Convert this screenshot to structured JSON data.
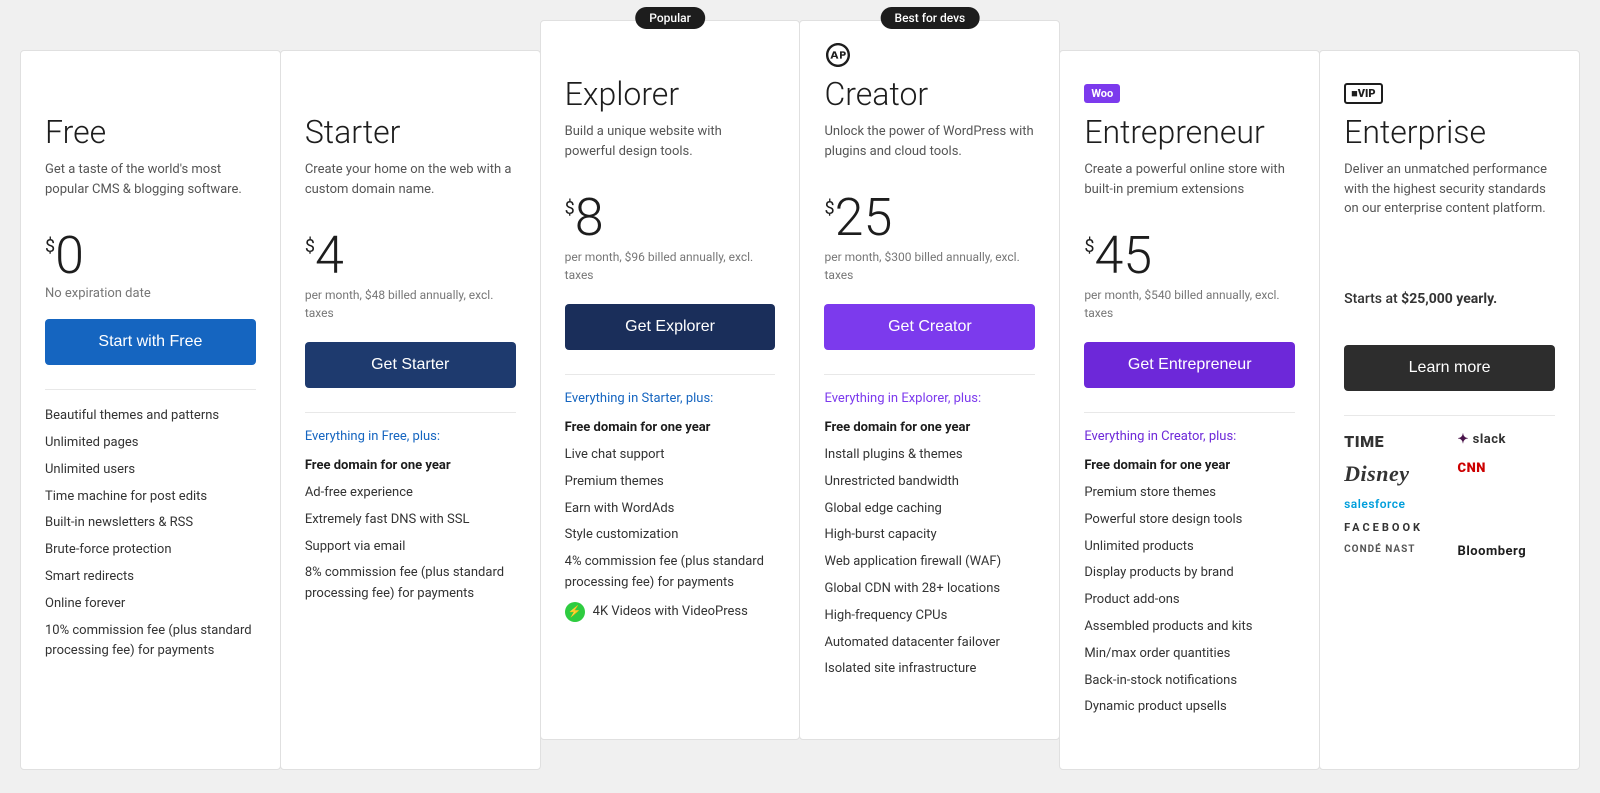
{
  "plans": [
    {
      "id": "free",
      "name": "Free",
      "badge": null,
      "icon": null,
      "desc": "Get a taste of the world's most popular CMS & blogging software.",
      "price": "0",
      "price_sub": "No expiration date",
      "cta_label": "Start with Free",
      "cta_class": "cta-blue",
      "everything_label": null,
      "features": [
        {
          "text": "Beautiful themes and patterns",
          "bold": false
        },
        {
          "text": "Unlimited pages",
          "bold": false
        },
        {
          "text": "Unlimited users",
          "bold": false
        },
        {
          "text": "Time machine for post edits",
          "bold": false
        },
        {
          "text": "Built-in newsletters & RSS",
          "bold": false
        },
        {
          "text": "Brute-force protection",
          "bold": false
        },
        {
          "text": "Smart redirects",
          "bold": false
        },
        {
          "text": "Online forever",
          "bold": false
        },
        {
          "text": "10% commission fee (plus standard processing fee) for payments",
          "bold": false
        }
      ]
    },
    {
      "id": "starter",
      "name": "Starter",
      "badge": null,
      "icon": null,
      "desc": "Create your home on the web with a custom domain name.",
      "price": "4",
      "price_sub": "per month, $48 billed annually, excl. taxes",
      "cta_label": "Get Starter",
      "cta_class": "cta-dark-blue",
      "everything_label": "Everything in Free, plus:",
      "everything_color": "blue",
      "features": [
        {
          "text": "Free domain for one year",
          "bold": true
        },
        {
          "text": "Ad-free experience",
          "bold": false
        },
        {
          "text": "Extremely fast DNS with SSL",
          "bold": false
        },
        {
          "text": "Support via email",
          "bold": false
        },
        {
          "text": "8% commission fee (plus standard processing fee) for payments",
          "bold": false
        }
      ]
    },
    {
      "id": "explorer",
      "name": "Explorer",
      "badge": "Popular",
      "icon": null,
      "desc": "Build a unique website with powerful design tools.",
      "price": "8",
      "price_sub": "per month, $96 billed annually, excl. taxes",
      "cta_label": "Get Explorer",
      "cta_class": "cta-navy",
      "everything_label": "Everything in Starter, plus:",
      "everything_color": "blue",
      "features": [
        {
          "text": "Free domain for one year",
          "bold": true
        },
        {
          "text": "Live chat support",
          "bold": false
        },
        {
          "text": "Premium themes",
          "bold": false
        },
        {
          "text": "Earn with WordAds",
          "bold": false
        },
        {
          "text": "Style customization",
          "bold": false
        },
        {
          "text": "4% commission fee (plus standard processing fee) for payments",
          "bold": false
        },
        {
          "text": "4K Videos with VideoPress",
          "bold": false,
          "green_icon": true
        }
      ]
    },
    {
      "id": "creator",
      "name": "Creator",
      "badge": "Best for devs",
      "icon": "wp",
      "desc": "Unlock the power of WordPress with plugins and cloud tools.",
      "price": "25",
      "price_sub": "per month, $300 billed annually, excl. taxes",
      "cta_label": "Get Creator",
      "cta_class": "cta-purple",
      "everything_label": "Everything in Explorer, plus:",
      "everything_color": "purple",
      "features": [
        {
          "text": "Free domain for one year",
          "bold": true
        },
        {
          "text": "Install plugins & themes",
          "bold": false
        },
        {
          "text": "Unrestricted bandwidth",
          "bold": false
        },
        {
          "text": "Global edge caching",
          "bold": false
        },
        {
          "text": "High-burst capacity",
          "bold": false
        },
        {
          "text": "Web application firewall (WAF)",
          "bold": false
        },
        {
          "text": "Global CDN with 28+ locations",
          "bold": false
        },
        {
          "text": "High-frequency CPUs",
          "bold": false
        },
        {
          "text": "Automated datacenter failover",
          "bold": false
        },
        {
          "text": "Isolated site infrastructure",
          "bold": false
        }
      ]
    },
    {
      "id": "entrepreneur",
      "name": "Entrepreneur",
      "badge": null,
      "icon": "woo",
      "desc": "Create a powerful online store with built-in premium extensions",
      "price": "45",
      "price_sub": "per month, $540 billed annually, excl. taxes",
      "cta_label": "Get Entrepreneur",
      "cta_class": "cta-violet",
      "everything_label": "Everything in Creator, plus:",
      "everything_color": "violet",
      "features": [
        {
          "text": "Free domain for one year",
          "bold": true
        },
        {
          "text": "Premium store themes",
          "bold": false
        },
        {
          "text": "Powerful store design tools",
          "bold": false
        },
        {
          "text": "Unlimited products",
          "bold": false
        },
        {
          "text": "Display products by brand",
          "bold": false
        },
        {
          "text": "Product add-ons",
          "bold": false
        },
        {
          "text": "Assembled products and kits",
          "bold": false
        },
        {
          "text": "Min/max order quantities",
          "bold": false
        },
        {
          "text": "Back-in-stock notifications",
          "bold": false
        },
        {
          "text": "Dynamic product upsells",
          "bold": false
        }
      ]
    },
    {
      "id": "enterprise",
      "name": "Enterprise",
      "badge": null,
      "icon": "vip",
      "desc": "Deliver an unmatched performance with the highest security standards on our enterprise content platform.",
      "price": null,
      "price_sub": "Starts at $25,000 yearly.",
      "cta_label": "Learn more",
      "cta_class": "cta-dark",
      "everything_label": null,
      "logos": [
        {
          "text": "TIME",
          "class": "time"
        },
        {
          "text": "⬛ slack",
          "class": "slack"
        },
        {
          "text": "Disney",
          "class": "disney"
        },
        {
          "text": "CNN",
          "class": "cnn"
        },
        {
          "text": "salesforce",
          "class": "salesforce"
        },
        {
          "text": "FACEBOOK",
          "class": "facebook"
        },
        {
          "text": "CONDÉ NAST",
          "class": "conde"
        },
        {
          "text": "Bloomberg",
          "class": "bloomberg"
        }
      ]
    }
  ]
}
